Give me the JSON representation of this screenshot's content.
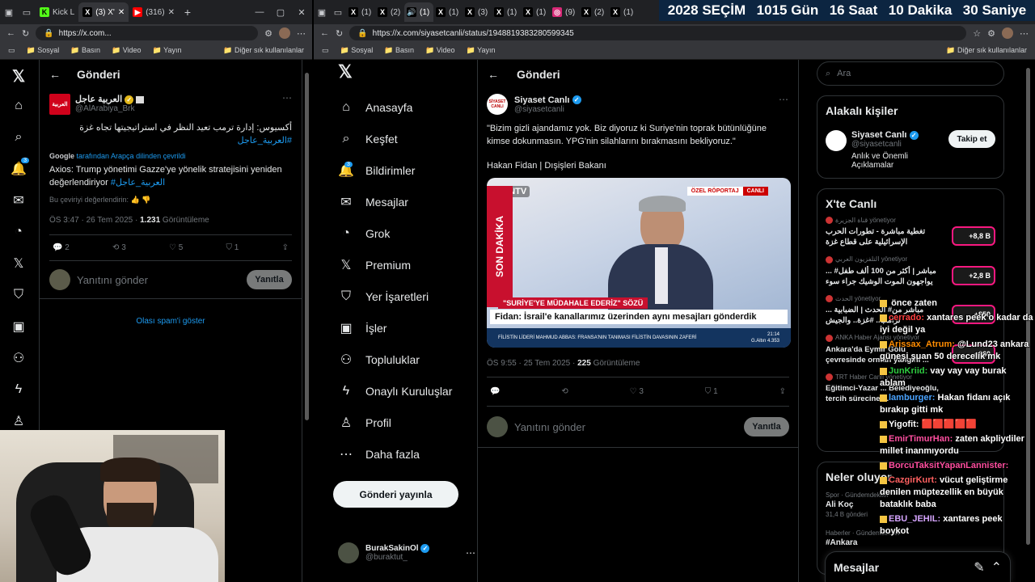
{
  "left_browser": {
    "tabs": [
      {
        "label": "Kick L",
        "color": "#53fc18",
        "glyph": "K"
      },
      {
        "label": "(3) X'",
        "color": "#000000",
        "glyph": "X",
        "active": true
      },
      {
        "label": "(316)",
        "color": "#ff0000",
        "glyph": "▶"
      }
    ],
    "url": "https://x.com...",
    "bookmarks": [
      "Sosyal",
      "Basın",
      "Video",
      "Yayın"
    ],
    "other_bookmarks": "Diğer sık kullanılanlar"
  },
  "left_x": {
    "header": "Gönderi",
    "notif_badge": "3",
    "tweet": {
      "name": "العربية عاجل",
      "handle": "@AlArabiya_Brk",
      "avatar_text": "العربية",
      "arabic_text": "أكسيوس: إدارة ترمب تعيد النظر في استراتيجيتها تجاه غزة",
      "arabic_tag": "#العربية_عاجل",
      "google": "Google",
      "translated_from": "tarafından Arapça dilinden çevrildi",
      "translation": "Axios: Trump yönetimi Gazze'ye yönelik stratejisini yeniden değerlendiriyor",
      "translation_tag": "#العربية_عاجل",
      "rate": "Bu çeviriyi değerlendirin:",
      "time": "ÖS 3:47 · 26 Tem 2025 ·",
      "views": "1.231",
      "views_label": "Görüntüleme",
      "replies": "2",
      "reposts": "3",
      "likes": "5",
      "bookmarks": "1"
    },
    "reply_placeholder": "Yanıtını gönder",
    "reply_button": "Yanıtla",
    "spam": "Olası spam'i göster"
  },
  "overlay": {
    "items": [
      {
        "value": "2028",
        "label": "SEÇİM"
      },
      {
        "value": "1015",
        "label": "Gün"
      },
      {
        "value": "16",
        "label": "Saat"
      },
      {
        "value": "10",
        "label": "Dakika"
      },
      {
        "value": "30",
        "label": "Saniye"
      }
    ]
  },
  "right_browser": {
    "tab_count_labels": [
      "(1)",
      "(2)",
      "(1)",
      "(1)",
      "(3)",
      "(1)",
      "(1)",
      "(9)",
      "(2)",
      "(1)"
    ],
    "url": "https://x.com/siyasetcanli/status/1948819383280599345",
    "bookmarks": [
      "Sosyal",
      "Basın",
      "Video",
      "Yayın"
    ],
    "other_bookmarks": "Diğer sık kullanılanlar"
  },
  "right_nav": {
    "items": [
      {
        "label": "Anasayfa",
        "icon": "home-icon",
        "glyph": "⌂"
      },
      {
        "label": "Keşfet",
        "icon": "search-icon",
        "glyph": "⌕"
      },
      {
        "label": "Bildirimler",
        "icon": "bell-icon",
        "glyph": "🔔"
      },
      {
        "label": "Mesajlar",
        "icon": "mail-icon",
        "glyph": "✉"
      },
      {
        "label": "Grok",
        "icon": "grok-icon",
        "glyph": "◔"
      },
      {
        "label": "Premium",
        "icon": "x-icon",
        "glyph": "𝕏"
      },
      {
        "label": "Yer İşaretleri",
        "icon": "bookmark-icon",
        "glyph": "⛉"
      },
      {
        "label": "İşler",
        "icon": "briefcase-icon",
        "glyph": "▣"
      },
      {
        "label": "Topluluklar",
        "icon": "people-icon",
        "glyph": "⚇"
      },
      {
        "label": "Onaylı Kuruluşlar",
        "icon": "lightning-icon",
        "glyph": "ϟ"
      },
      {
        "label": "Profil",
        "icon": "person-icon",
        "glyph": "♙"
      },
      {
        "label": "Daha fazla",
        "icon": "more-icon",
        "glyph": "⋯"
      }
    ],
    "notif_badge": "3",
    "post_button": "Gönderi yayınla",
    "user_name": "BurakSakinOl",
    "user_handle": "@buraktut_"
  },
  "main_tweet": {
    "header": "Gönderi",
    "name": "Siyaset Canlı",
    "handle": "@siyasetcanli",
    "avatar_text": "SİYASET CANLI",
    "text": "\"Bizim gizli ajandamız yok. Biz diyoruz ki Suriye'nin toprak bütünlüğüne kimse dokunmasın. YPG'nin silahlarını bırakmasını bekliyoruz.\"",
    "attribution": "Hakan Fidan | Dışişleri Bakanı",
    "video": {
      "channel": "NTV",
      "badge1": "ÖZEL RÖPORTAJ",
      "badge2": "CANLI",
      "vertical": "SON DAKİKA",
      "strap_quote": "\"SURİYE'YE MÜDAHALE EDERİZ\" SÖZÜ",
      "headline": "Fidan: İsrail'e kanallarımız üzerinden aynı mesajları gönderdik",
      "ticker": "FİLİSTİN LİDERİ MAHMUD ABBAS: FRANSA'NIN TANIMASI FİLİSTİN DAVASININ ZAFERİ",
      "clock": "21:14",
      "gold": "G.Altın 4.353"
    },
    "time": "ÖS 9:55 · 25 Tem 2025 ·",
    "views": "225",
    "views_label": "Görüntüleme",
    "likes": "3",
    "bookmarks": "1",
    "reply_placeholder": "Yanıtını gönder",
    "reply_button": "Yanıtla"
  },
  "sidebar": {
    "search_placeholder": "Ara",
    "related_title": "Alakalı kişiler",
    "related": {
      "name": "Siyaset Canlı",
      "handle": "@siyasetcanli",
      "bio": "Anlık ve Önemli Açıklamalar",
      "follow": "Takip et"
    },
    "live_title": "X'te Canlı",
    "live": [
      {
        "host": "قناة الجزيرة",
        "role": "yönetiyor",
        "title": "تغطية مباشرة - تطورات الحرب الإسرائيلية على قطاع غزة",
        "count": "+8,8 B"
      },
      {
        "host": "التلفزيون العربي",
        "role": "yönetiyor",
        "title": "مباشر | أكثر من 100 ألف طفل# ... يواجهون الموت الوشيك جراء سوء",
        "count": "+2,8 B"
      },
      {
        "host": "الحدث",
        "role": "yönetiyor",
        "title": "مباشر من# الحدث | الضبابية ... ترامب.. #غزة.. والجيش",
        "count": "+850"
      },
      {
        "host": "ANKA Haber Ajansı",
        "role": "yönetiyor",
        "title": "Ankara'da Eymir Gölü çevresinde orman yangını ...",
        "count": "+660"
      },
      {
        "host": "TRT Haber Canlı",
        "role": "yönetiyor",
        "title": "Eğitimci-Yazar ... Belediyeoğlu, tercih sürecine ...",
        "count": ""
      }
    ],
    "trends_title": "Neler oluyor",
    "trends": [
      {
        "meta": "Spor · Gündemdekiler",
        "name": "Ali Koç",
        "count": "31,4 B gönderi"
      },
      {
        "meta": "Haberler · Gündemdekiler",
        "name": "#Ankara",
        "count": ""
      }
    ],
    "messages": "Mesajlar"
  },
  "chat": [
    {
      "user": "",
      "color": "#ffffff",
      "msg": "önce zaten"
    },
    {
      "user": "cerrado:",
      "color": "#ff4040",
      "msg": "xantares peek o kadar da iyi değil ya"
    },
    {
      "user": "Arissax_Atrum:",
      "color": "#ff8c00",
      "msg": "@Lund23 ankara güneşi şuan 50 derecelik mk"
    },
    {
      "user": "JunKriid:",
      "color": "#2ecc40",
      "msg": "vay vay vay burak ablam"
    },
    {
      "user": "lamburger:",
      "color": "#4aa3ff",
      "msg": "Hakan fidanı açık bırakıp gitti mk"
    },
    {
      "user": "Yigofit:",
      "color": "#ffffff",
      "msg": "🟥🟥🟥🟥🟥"
    },
    {
      "user": "EmirTimurHan:",
      "color": "#ff4fa0",
      "msg": "zaten akpliydiler millet inanmıyordu"
    },
    {
      "user": "BorcuTaksitYapanLannister:",
      "color": "#ff4fa0",
      "msg": ""
    },
    {
      "user": "CazgirKurt:",
      "color": "#ff6060",
      "msg": "vücut geliştirme denilen müptezellik en büyük bataklık baba"
    },
    {
      "user": "EBU_JEHIL:",
      "color": "#d6a5ff",
      "msg": "xantares peek boykot"
    }
  ]
}
